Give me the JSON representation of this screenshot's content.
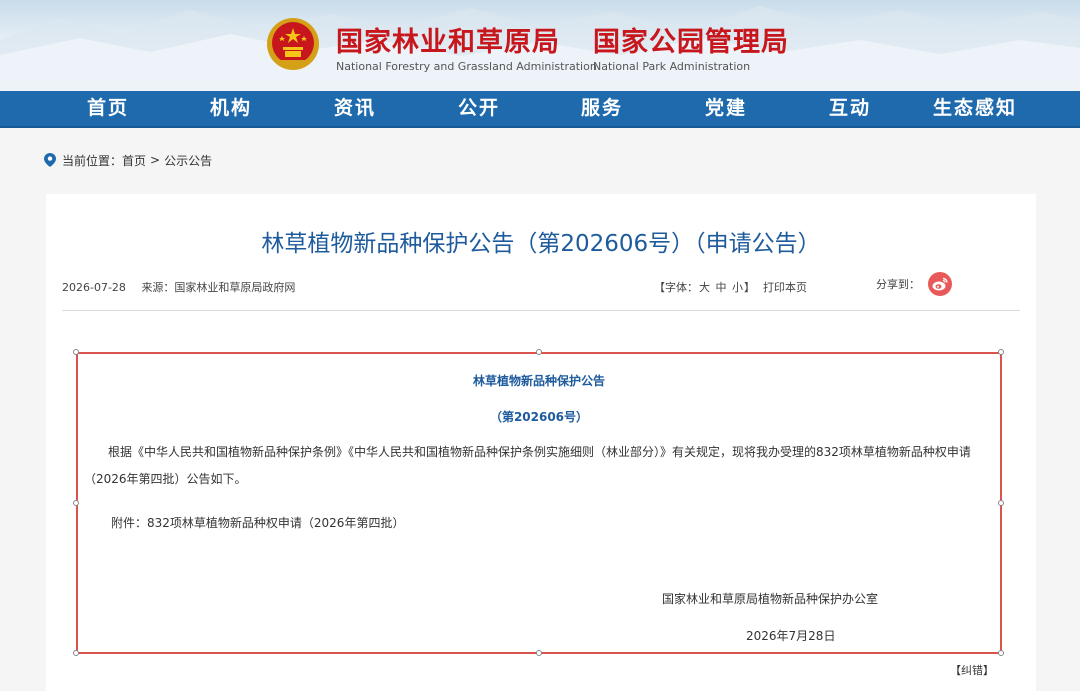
{
  "header": {
    "org1_cn": "国家林业和草原局",
    "org1_en": "National Forestry and Grassland Administration",
    "org2_cn": "国家公园管理局",
    "org2_en": "National Park Administration"
  },
  "nav": {
    "items": [
      "首页",
      "机构",
      "资讯",
      "公开",
      "服务",
      "党建",
      "互动",
      "生态感知"
    ]
  },
  "breadcrumb": {
    "label": "当前位置：",
    "home": "首页",
    "separator": ">",
    "current": "公示公告"
  },
  "article": {
    "title": "林草植物新品种保护公告（第202606号）（申请公告）",
    "date": "2026-07-28",
    "source": "来源：国家林业和草原局政府网",
    "font_label": "【字体：",
    "font_large": "大",
    "font_medium": "中",
    "font_small": "小",
    "font_close": "】",
    "print": "打印本页",
    "share_label": "分享到："
  },
  "notice": {
    "heading": "林草植物新品种保护公告",
    "number": "（第202606号）",
    "body": "根据《中华人民共和国植物新品种保护条例》《中华人民共和国植物新品种保护条例实施细则（林业部分）》有关规定，现将我办受理的832项林草植物新品种权申请（2026年第四批）公告如下。",
    "attachment": "附件：832项林草植物新品种权申请（2026年第四批）",
    "signature": "国家林业和草原局植物新品种保护办公室",
    "sign_date": "2026年7月28日"
  },
  "correction": "【纠错】",
  "colors": {
    "nav_blue": "#1e6aad",
    "title_red": "#c8161d",
    "title_blue": "#1e5b9c",
    "box_red": "#d9534f"
  }
}
